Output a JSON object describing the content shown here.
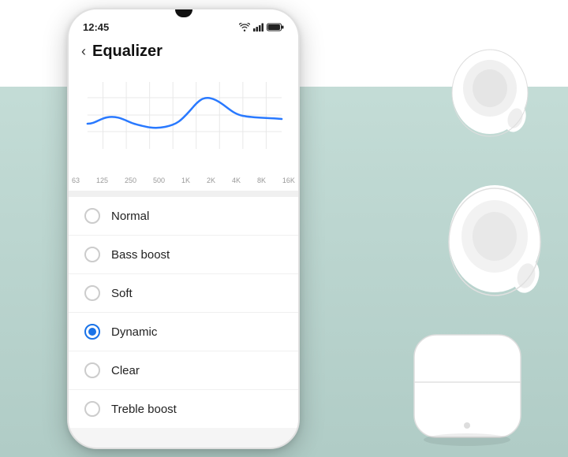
{
  "background": {
    "color": "#b8d8d0"
  },
  "phone": {
    "status_bar": {
      "time": "12:45",
      "battery": "100%",
      "wifi": true,
      "signal": true
    },
    "header": {
      "back_label": "‹",
      "title": "Equalizer"
    },
    "chart": {
      "x_labels": [
        "63",
        "125",
        "250",
        "500",
        "1K",
        "2K",
        "4K",
        "8K",
        "16K"
      ]
    },
    "options": [
      {
        "id": "normal",
        "label": "Normal",
        "selected": false
      },
      {
        "id": "bass-boost",
        "label": "Bass boost",
        "selected": false
      },
      {
        "id": "soft",
        "label": "Soft",
        "selected": false
      },
      {
        "id": "dynamic",
        "label": "Dynamic",
        "selected": true
      },
      {
        "id": "clear",
        "label": "Clear",
        "selected": false
      },
      {
        "id": "treble-boost",
        "label": "Treble boost",
        "selected": false
      }
    ]
  }
}
